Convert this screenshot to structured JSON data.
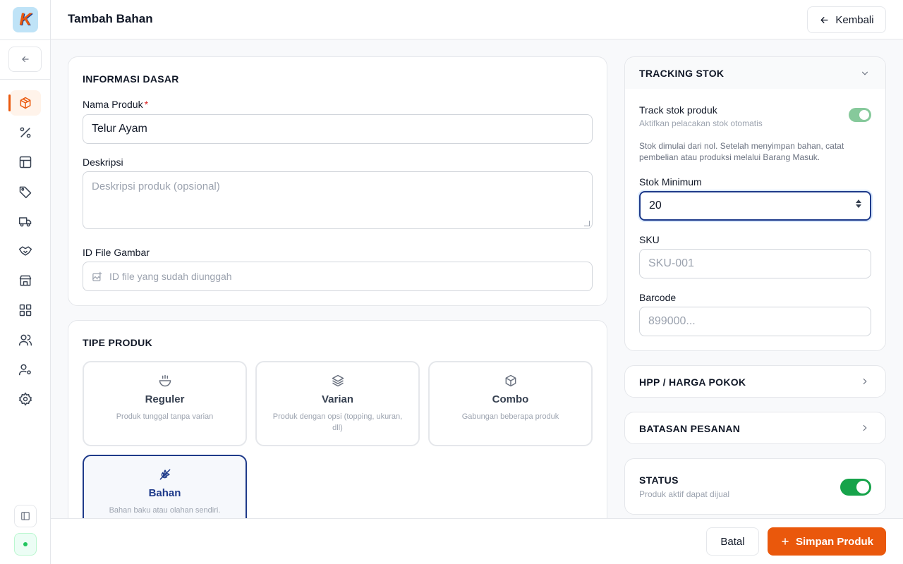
{
  "app": {
    "logo_letter": "K",
    "page_title": "Tambah Bahan",
    "back_label": "Kembali"
  },
  "sidebar": {
    "items": [
      {
        "icon": "box-icon",
        "active": true
      },
      {
        "icon": "percent-icon"
      },
      {
        "icon": "layout-icon"
      },
      {
        "icon": "tag-icon"
      },
      {
        "icon": "truck-icon"
      },
      {
        "icon": "handshake-icon"
      },
      {
        "icon": "store-icon"
      },
      {
        "icon": "grid-icon"
      },
      {
        "icon": "users-icon"
      },
      {
        "icon": "user-cog-icon"
      },
      {
        "icon": "settings-icon"
      }
    ]
  },
  "basic_info": {
    "title": "INFORMASI DASAR",
    "name_label": "Nama Produk",
    "name_required": "*",
    "name_value": "Telur Ayam",
    "desc_label": "Deskripsi",
    "desc_placeholder": "Deskripsi produk (opsional)",
    "image_label": "ID File Gambar",
    "image_placeholder": "ID file yang sudah diunggah"
  },
  "product_type": {
    "title": "TIPE PRODUK",
    "options": [
      {
        "name": "Reguler",
        "desc": "Produk tunggal tanpa varian"
      },
      {
        "name": "Varian",
        "desc": "Produk dengan opsi (topping, ukuran, dll)"
      },
      {
        "name": "Combo",
        "desc": "Gabungan beberapa produk"
      },
      {
        "name": "Bahan",
        "desc": "Bahan baku atau olahan sendiri."
      }
    ],
    "selected": "Bahan"
  },
  "tracking": {
    "title": "TRACKING STOK",
    "track_label": "Track stok produk",
    "track_sub": "Aktifkan pelacakan stok otomatis",
    "track_enabled": true,
    "helper": "Stok dimulai dari nol. Setelah menyimpan bahan, catat pembelian atau produksi melalui Barang Masuk.",
    "min_label": "Stok Minimum",
    "min_value": "20",
    "sku_label": "SKU",
    "sku_placeholder": "SKU-001",
    "barcode_label": "Barcode",
    "barcode_placeholder": "899000..."
  },
  "hpp": {
    "title": "HPP / HARGA POKOK"
  },
  "order_limit": {
    "title": "BATASAN PESANAN"
  },
  "status": {
    "title": "STATUS",
    "sub": "Produk aktif dapat dijual",
    "enabled": true
  },
  "footer": {
    "cancel_label": "Batal",
    "save_label": "Simpan Produk"
  },
  "colors": {
    "accent": "#ea580c",
    "navy": "#1e3a8a",
    "success": "#16a34a"
  }
}
